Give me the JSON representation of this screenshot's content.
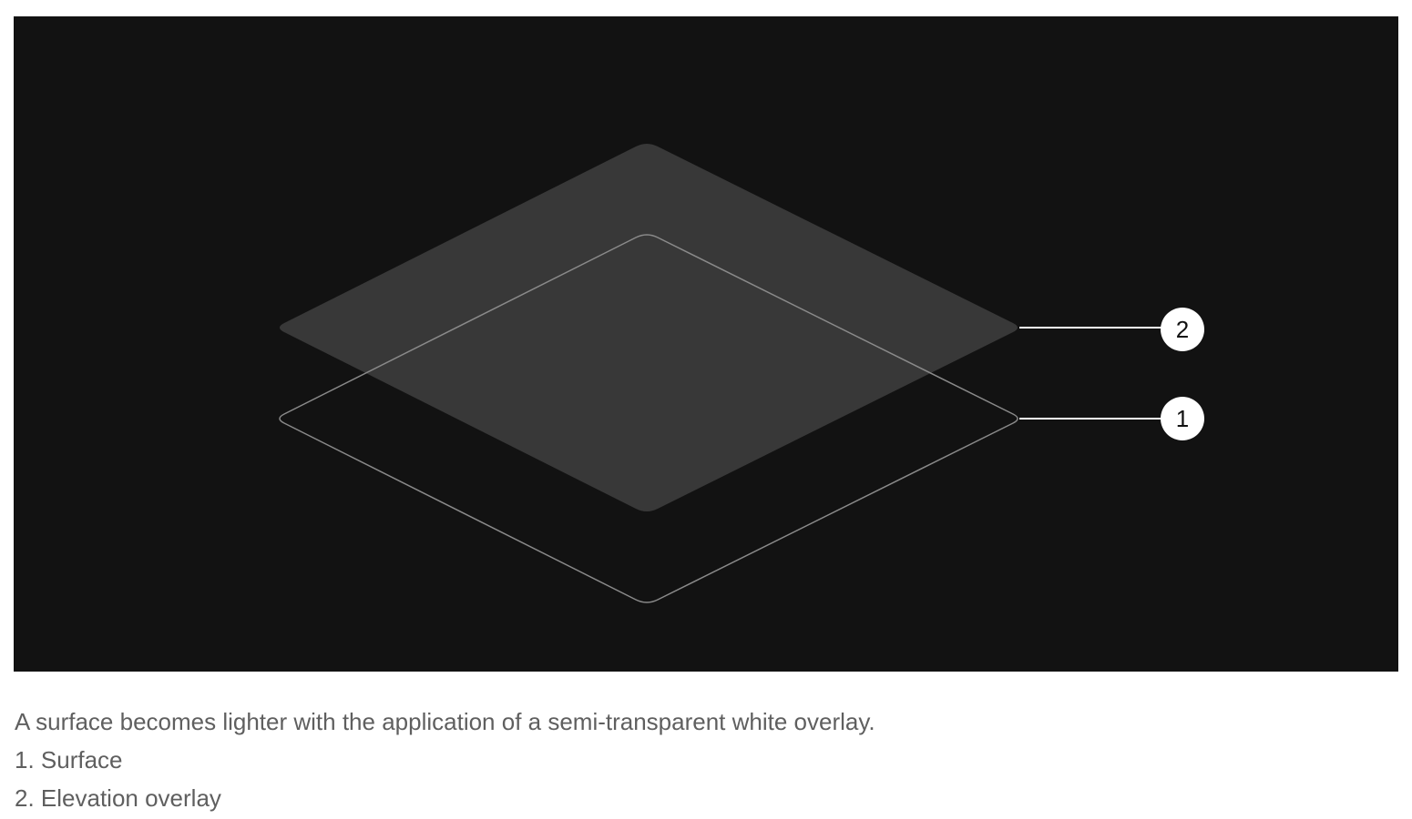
{
  "diagram": {
    "callouts": [
      {
        "number": "1",
        "target": "Surface"
      },
      {
        "number": "2",
        "target": "Elevation overlay"
      }
    ],
    "colors": {
      "background": "#121212",
      "overlay_fill": "#383838",
      "surface_outline": "#8a8a8a",
      "callout_line": "#ffffff",
      "callout_circle": "#ffffff",
      "callout_text": "#121212",
      "caption_text": "#5f5f5f"
    }
  },
  "caption": {
    "description": "A surface becomes lighter with the application of a semi-transparent white overlay.",
    "items": [
      "1. Surface",
      "2. Elevation overlay"
    ]
  }
}
